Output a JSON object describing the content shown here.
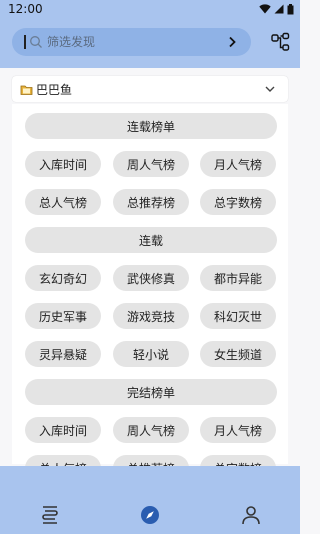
{
  "status": {
    "time": "12:00"
  },
  "search": {
    "placeholder": "筛选发现"
  },
  "group": {
    "label": "巴巴鱼"
  },
  "sections": [
    {
      "title": "连载榜单",
      "tags": [
        "入库时间",
        "周人气榜",
        "月人气榜",
        "总人气榜",
        "总推荐榜",
        "总字数榜"
      ]
    },
    {
      "title": "连载",
      "tags": [
        "玄幻奇幻",
        "武侠修真",
        "都市异能",
        "历史军事",
        "游戏竞技",
        "科幻灭世",
        "灵异悬疑",
        "轻小说",
        "女生频道"
      ]
    },
    {
      "title": "完结榜单",
      "tags": [
        "入库时间",
        "周人气榜",
        "月人气榜",
        "总人气榜",
        "总推荐榜",
        "总字数榜"
      ]
    }
  ],
  "nav": {
    "items": [
      {
        "icon": "bookshelf-icon"
      },
      {
        "icon": "compass-icon",
        "active": true
      },
      {
        "icon": "person-icon"
      }
    ]
  },
  "colors": {
    "header": "#a9c4ee",
    "search": "#8fb2e6",
    "pill": "#e4e4e4",
    "accent": "#2a5db0"
  }
}
